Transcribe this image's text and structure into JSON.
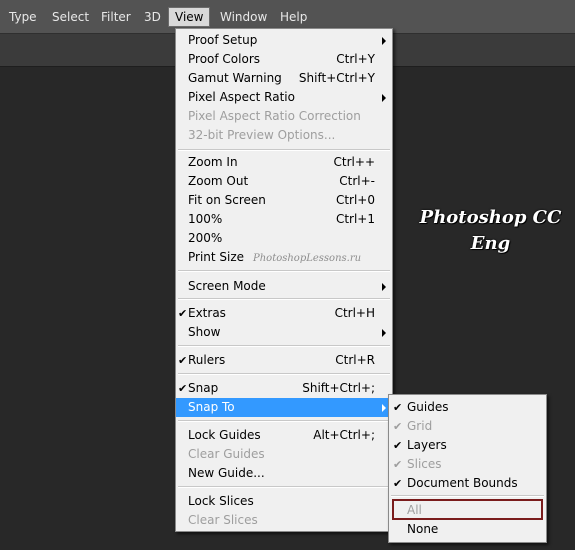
{
  "menubar": {
    "items": [
      "Type",
      "Select",
      "Filter",
      "3D",
      "View",
      "Window",
      "Help"
    ],
    "active": "View"
  },
  "watermark": {
    "line1": "Photoshop  CC",
    "line2": "Eng",
    "site": "PhotoshopLessons.ru"
  },
  "view_menu": {
    "items": [
      {
        "label": "Proof Setup",
        "submenu": true
      },
      {
        "label": "Proof Colors",
        "shortcut": "Ctrl+Y"
      },
      {
        "label": "Gamut Warning",
        "shortcut": "Shift+Ctrl+Y"
      },
      {
        "label": "Pixel Aspect Ratio",
        "submenu": true
      },
      {
        "label": "Pixel Aspect Ratio Correction",
        "disabled": true
      },
      {
        "label": "32-bit Preview Options...",
        "disabled": true
      },
      {
        "label": "Zoom In",
        "shortcut": "Ctrl++"
      },
      {
        "label": "Zoom Out",
        "shortcut": "Ctrl+-"
      },
      {
        "label": "Fit on Screen",
        "shortcut": "Ctrl+0"
      },
      {
        "label": "100%",
        "shortcut": "Ctrl+1"
      },
      {
        "label": "200%"
      },
      {
        "label": "Print Size"
      },
      {
        "label": "Screen Mode",
        "submenu": true
      },
      {
        "label": "Extras",
        "shortcut": "Ctrl+H",
        "checked": true
      },
      {
        "label": "Show",
        "submenu": true
      },
      {
        "label": "Rulers",
        "shortcut": "Ctrl+R",
        "checked": true
      },
      {
        "label": "Snap",
        "shortcut": "Shift+Ctrl+;",
        "checked": true
      },
      {
        "label": "Snap To",
        "submenu": true,
        "highlighted": true
      },
      {
        "label": "Lock Guides",
        "shortcut": "Alt+Ctrl+;"
      },
      {
        "label": "Clear Guides",
        "disabled": true
      },
      {
        "label": "New Guide..."
      },
      {
        "label": "Lock Slices"
      },
      {
        "label": "Clear Slices",
        "disabled": true
      }
    ]
  },
  "snap_to_menu": {
    "items": [
      {
        "label": "Guides",
        "checked": true
      },
      {
        "label": "Grid",
        "checked": true,
        "disabled": true
      },
      {
        "label": "Layers",
        "checked": true
      },
      {
        "label": "Slices",
        "checked": true,
        "disabled": true
      },
      {
        "label": "Document Bounds",
        "checked": true
      },
      {
        "label": "All",
        "disabled": true
      },
      {
        "label": "None"
      }
    ]
  },
  "colors": {
    "highlight": "#3399ff",
    "menu_bg": "#f0f0f0",
    "canvas_bg": "#282828",
    "annotation_box": "#7a1c1c"
  }
}
